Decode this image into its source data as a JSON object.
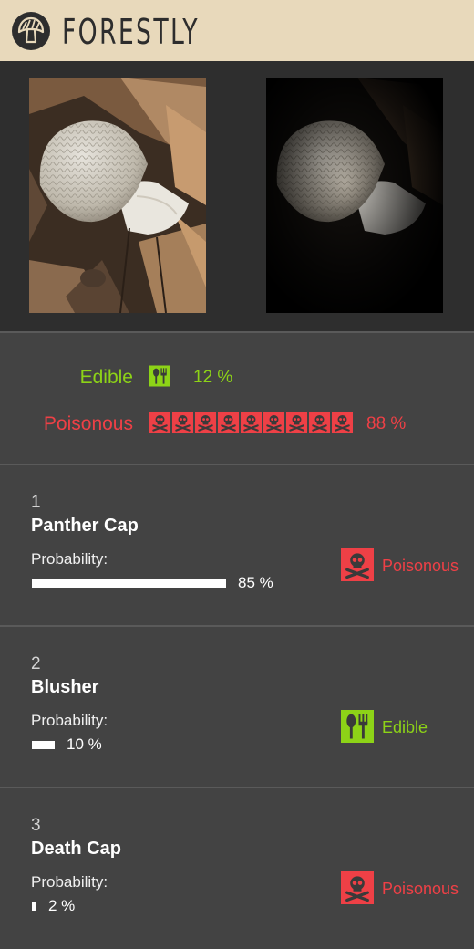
{
  "header": {
    "app_title": "FORESTLY",
    "logo_icon": "mushroom-logo-icon"
  },
  "photos": {
    "original": "mushroom-photo-original",
    "processed": "mushroom-photo-processed"
  },
  "summary": {
    "edible": {
      "label": "Edible",
      "percent": "12 %",
      "icon_count": 1,
      "icon": "fork-spoon-icon",
      "color": "#8dd317"
    },
    "poisonous": {
      "label": "Poisonous",
      "percent": "88 %",
      "icon_count": 9,
      "icon": "skull-crossbones-icon",
      "color": "#ee4046"
    }
  },
  "results": [
    {
      "rank": "1",
      "name": "Panther Cap",
      "probability_label": "Probability:",
      "percent": "85 %",
      "probability": 0.85,
      "toxicity": "Poisonous",
      "toxicity_icon": "skull-crossbones-icon"
    },
    {
      "rank": "2",
      "name": "Blusher",
      "probability_label": "Probability:",
      "percent": "10 %",
      "probability": 0.1,
      "toxicity": "Edible",
      "toxicity_icon": "fork-spoon-icon"
    },
    {
      "rank": "3",
      "name": "Death Cap",
      "probability_label": "Probability:",
      "percent": "2 %",
      "probability": 0.02,
      "toxicity": "Poisonous",
      "toxicity_icon": "skull-crossbones-icon"
    }
  ]
}
